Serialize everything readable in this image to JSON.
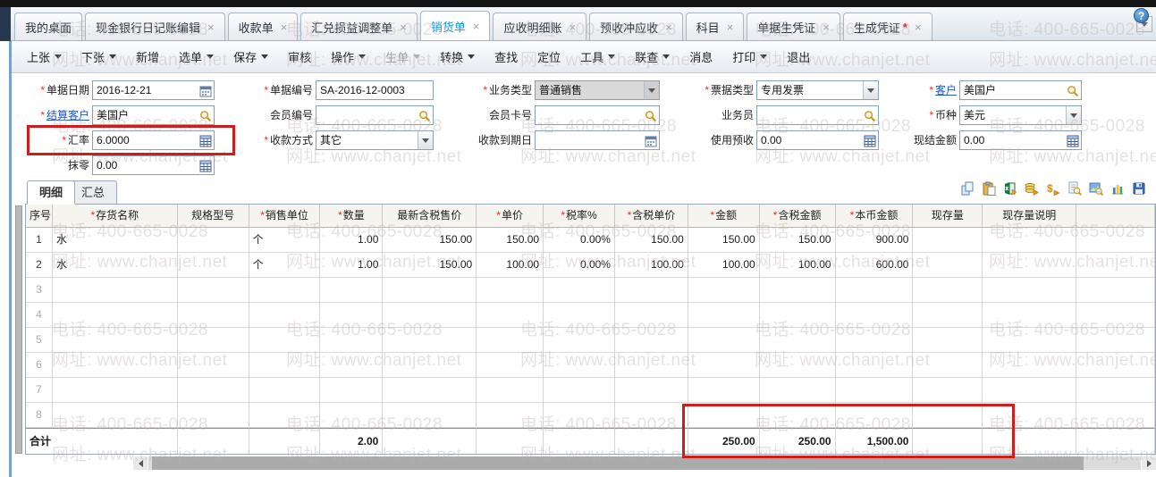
{
  "colors": {
    "highlight_box": "#cf1d1d",
    "active_tab_text": "#1d94d2",
    "link": "#1d56c8",
    "required_star": "#e03030"
  },
  "watermark": {
    "phone": "电话: 400-665-0028",
    "url": "网址: www.chanjet.net"
  },
  "close_glyph": "×",
  "tabs": [
    {
      "label": "我的桌面",
      "closable": false,
      "active": false
    },
    {
      "label": "现金银行日记账编辑",
      "closable": true,
      "active": false
    },
    {
      "label": "收款单",
      "closable": true,
      "active": false
    },
    {
      "label": "汇兑损益调整单",
      "closable": true,
      "active": false
    },
    {
      "label": "销货单",
      "closable": true,
      "active": true
    },
    {
      "label": "应收明细账",
      "closable": true,
      "active": false
    },
    {
      "label": "预收冲应收",
      "closable": true,
      "active": false
    },
    {
      "label": "科目",
      "closable": true,
      "active": false
    },
    {
      "label": "单据生凭证",
      "closable": true,
      "active": false
    },
    {
      "label": "生成凭证",
      "closable": true,
      "active": false,
      "modified": true
    }
  ],
  "toolbar": {
    "help_glyph": "?",
    "items": [
      {
        "label": "上张",
        "arrow": true
      },
      {
        "label": "下张",
        "arrow": true
      },
      {
        "label": "新增"
      },
      {
        "label": "选单",
        "arrow": true
      },
      {
        "label": "保存",
        "arrow": true
      },
      {
        "label": "审核"
      },
      {
        "label": "操作",
        "arrow": true
      },
      {
        "label": "生单",
        "arrow": true,
        "disabled": true
      },
      {
        "label": "转换",
        "arrow": true
      },
      {
        "label": "查找"
      },
      {
        "label": "定位"
      },
      {
        "label": "工具",
        "arrow": true
      },
      {
        "label": "联查",
        "arrow": true
      },
      {
        "label": "消息"
      },
      {
        "label": "打印",
        "arrow": true
      },
      {
        "label": "退出"
      }
    ]
  },
  "form": {
    "fields": [
      {
        "key": "doc-date",
        "row": 1,
        "col": 1,
        "label": "单据日期",
        "required": true,
        "value": "2016-12-21",
        "icon": "calendar-icon"
      },
      {
        "key": "doc-no",
        "row": 1,
        "col": 2,
        "label": "单据编号",
        "required": true,
        "value": "SA-2016-12-0003"
      },
      {
        "key": "biz-type",
        "row": 1,
        "col": 3,
        "label": "业务类型",
        "required": true,
        "value": "普通销售",
        "type": "select-disabled"
      },
      {
        "key": "invoice-type",
        "row": 1,
        "col": 4,
        "label": "票据类型",
        "required": true,
        "value": "专用发票",
        "type": "select"
      },
      {
        "key": "customer",
        "row": 1,
        "col": 5,
        "label": "客户",
        "required": true,
        "link": true,
        "value": "美国户",
        "icon": "magnifier-icon"
      },
      {
        "key": "settle-customer",
        "row": 2,
        "col": 1,
        "label": "结算客户",
        "required": true,
        "link": true,
        "value": "美国户",
        "icon": "magnifier-icon"
      },
      {
        "key": "member-no",
        "row": 2,
        "col": 2,
        "label": "会员编号",
        "required": false,
        "value": "",
        "icon": "magnifier-icon"
      },
      {
        "key": "member-card",
        "row": 2,
        "col": 3,
        "label": "会员卡号",
        "required": false,
        "value": "",
        "icon": "magnifier-icon"
      },
      {
        "key": "salesman",
        "row": 2,
        "col": 4,
        "label": "业务员",
        "required": false,
        "value": "",
        "icon": "magnifier-icon"
      },
      {
        "key": "currency",
        "row": 2,
        "col": 5,
        "label": "币种",
        "required": true,
        "value": "美元",
        "type": "select"
      },
      {
        "key": "exchange-rate",
        "row": 3,
        "col": 1,
        "label": "汇率",
        "required": true,
        "value": "6.0000",
        "icon": "calc-icon"
      },
      {
        "key": "payment-method",
        "row": 3,
        "col": 2,
        "label": "收款方式",
        "required": true,
        "value": "其它",
        "type": "select"
      },
      {
        "key": "due-date",
        "row": 3,
        "col": 3,
        "label": "收款到期日",
        "required": false,
        "value": "",
        "icon": "calendar-icon"
      },
      {
        "key": "advance-used",
        "row": 3,
        "col": 4,
        "label": "使用预收",
        "required": false,
        "value": "0.00",
        "icon": "calc-icon"
      },
      {
        "key": "cash-amount",
        "row": 3,
        "col": 5,
        "label": "现结金额",
        "required": false,
        "value": "0.00",
        "icon": "calc-icon"
      },
      {
        "key": "rounding",
        "row": 4,
        "col": 1,
        "label": "抹零",
        "required": false,
        "value": "0.00",
        "icon": "calc-icon"
      }
    ]
  },
  "detail": {
    "tabs": [
      "明细",
      "汇总"
    ],
    "grid_icons": [
      "copy-icon",
      "paste-icon",
      "excel-export-icon",
      "coin-batch-icon",
      "money-search-icon",
      "document-search-icon",
      "image-search-icon",
      "bar-chart-icon",
      "save-icon"
    ],
    "columns": [
      {
        "label": "序号",
        "required": false,
        "align": "ctr"
      },
      {
        "label": "存货名称",
        "required": true,
        "align": "left"
      },
      {
        "label": "规格型号",
        "required": false,
        "align": "left"
      },
      {
        "label": "销售单位",
        "required": true,
        "align": "left"
      },
      {
        "label": "数量",
        "required": true,
        "align": "num"
      },
      {
        "label": "最新含税售价",
        "required": false,
        "align": "num"
      },
      {
        "label": "单价",
        "required": true,
        "align": "num"
      },
      {
        "label": "税率%",
        "required": true,
        "align": "num"
      },
      {
        "label": "含税单价",
        "required": true,
        "align": "num"
      },
      {
        "label": "金额",
        "required": true,
        "align": "num"
      },
      {
        "label": "含税金额",
        "required": true,
        "align": "num"
      },
      {
        "label": "本币金额",
        "required": true,
        "align": "num"
      },
      {
        "label": "现存量",
        "required": false,
        "align": "num"
      },
      {
        "label": "现存量说明",
        "required": false,
        "align": "left"
      }
    ],
    "rows": [
      [
        "1",
        "水",
        "",
        "个",
        "1.00",
        "150.00",
        "150.00",
        "0.00%",
        "150.00",
        "150.00",
        "150.00",
        "900.00",
        "",
        ""
      ],
      [
        "2",
        "水",
        "",
        "个",
        "1.00",
        "150.00",
        "100.00",
        "0.00%",
        "100.00",
        "100.00",
        "100.00",
        "600.00",
        "",
        ""
      ],
      [
        "3",
        "",
        "",
        "",
        "",
        "",
        "",
        "",
        "",
        "",
        "",
        "",
        "",
        ""
      ],
      [
        "4",
        "",
        "",
        "",
        "",
        "",
        "",
        "",
        "",
        "",
        "",
        "",
        "",
        ""
      ],
      [
        "5",
        "",
        "",
        "",
        "",
        "",
        "",
        "",
        "",
        "",
        "",
        "",
        "",
        ""
      ],
      [
        "6",
        "",
        "",
        "",
        "",
        "",
        "",
        "",
        "",
        "",
        "",
        "",
        "",
        ""
      ],
      [
        "7",
        "",
        "",
        "",
        "",
        "",
        "",
        "",
        "",
        "",
        "",
        "",
        "",
        ""
      ],
      [
        "8",
        "",
        "",
        "",
        "",
        "",
        "",
        "",
        "",
        "",
        "",
        "",
        "",
        ""
      ]
    ],
    "footer": {
      "label": "合计",
      "quantity": "2.00",
      "amount": "250.00",
      "tax_amount": "250.00",
      "local_amount": "1,500.00"
    }
  }
}
